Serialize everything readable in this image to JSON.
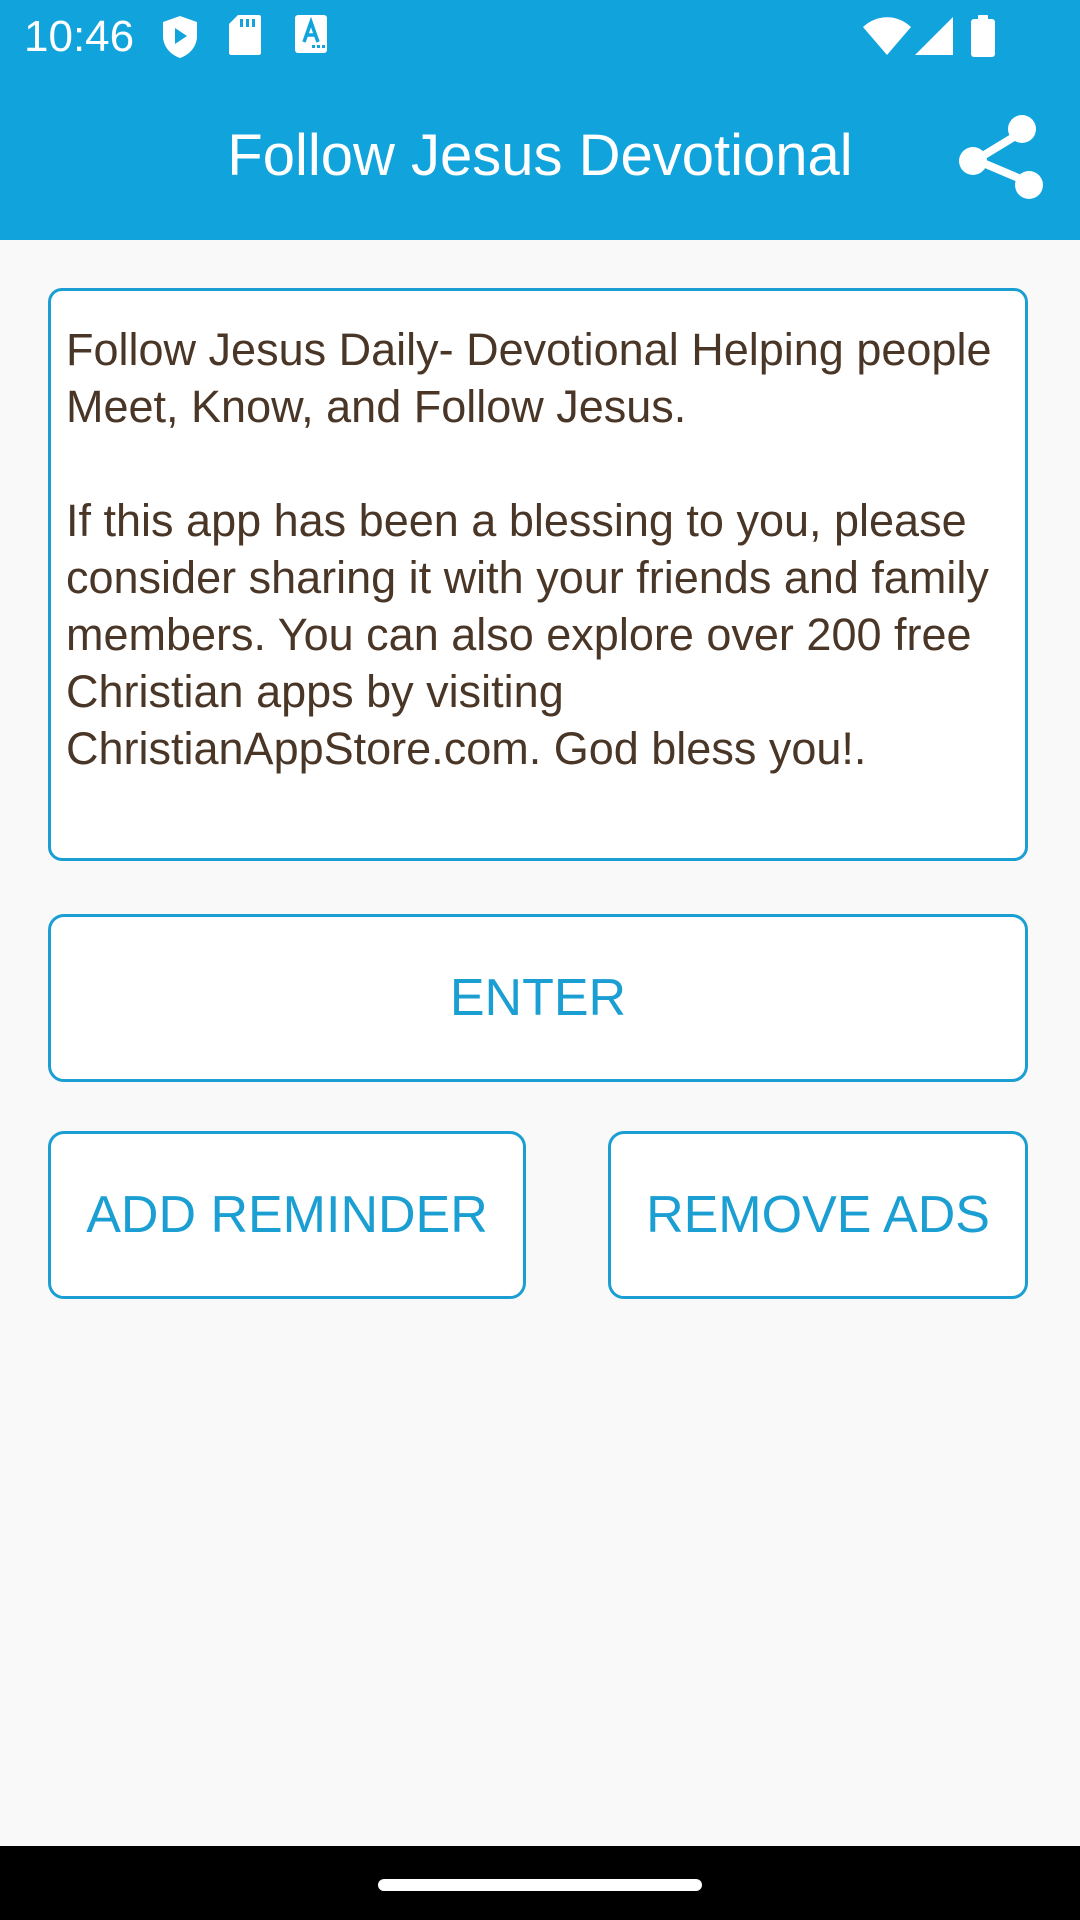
{
  "status_bar": {
    "time": "10:46",
    "left_icons": [
      "shield-icon",
      "sd-card-icon",
      "keyboard-a-icon"
    ],
    "right_icons": [
      "wifi-icon",
      "cell-signal-icon",
      "battery-icon"
    ]
  },
  "app_bar": {
    "title": "Follow Jesus Devotional",
    "share_icon": "share-icon"
  },
  "message": {
    "paragraph1": "Follow Jesus Daily- Devotional Helping people Meet, Know, and Follow Jesus.",
    "paragraph2": "If this app has been a blessing to you, please consider sharing it with your friends and family members. You can also explore over 200 free Christian apps by visiting ChristianAppStore.com. God bless you!."
  },
  "buttons": {
    "enter": "ENTER",
    "add_reminder": "ADD REMINDER",
    "remove_ads": "REMOVE ADS"
  },
  "colors": {
    "primary": "#11a3dc",
    "accent": "#1b9fd3",
    "text_brown": "#4a3626",
    "background": "#f9f9f9"
  }
}
